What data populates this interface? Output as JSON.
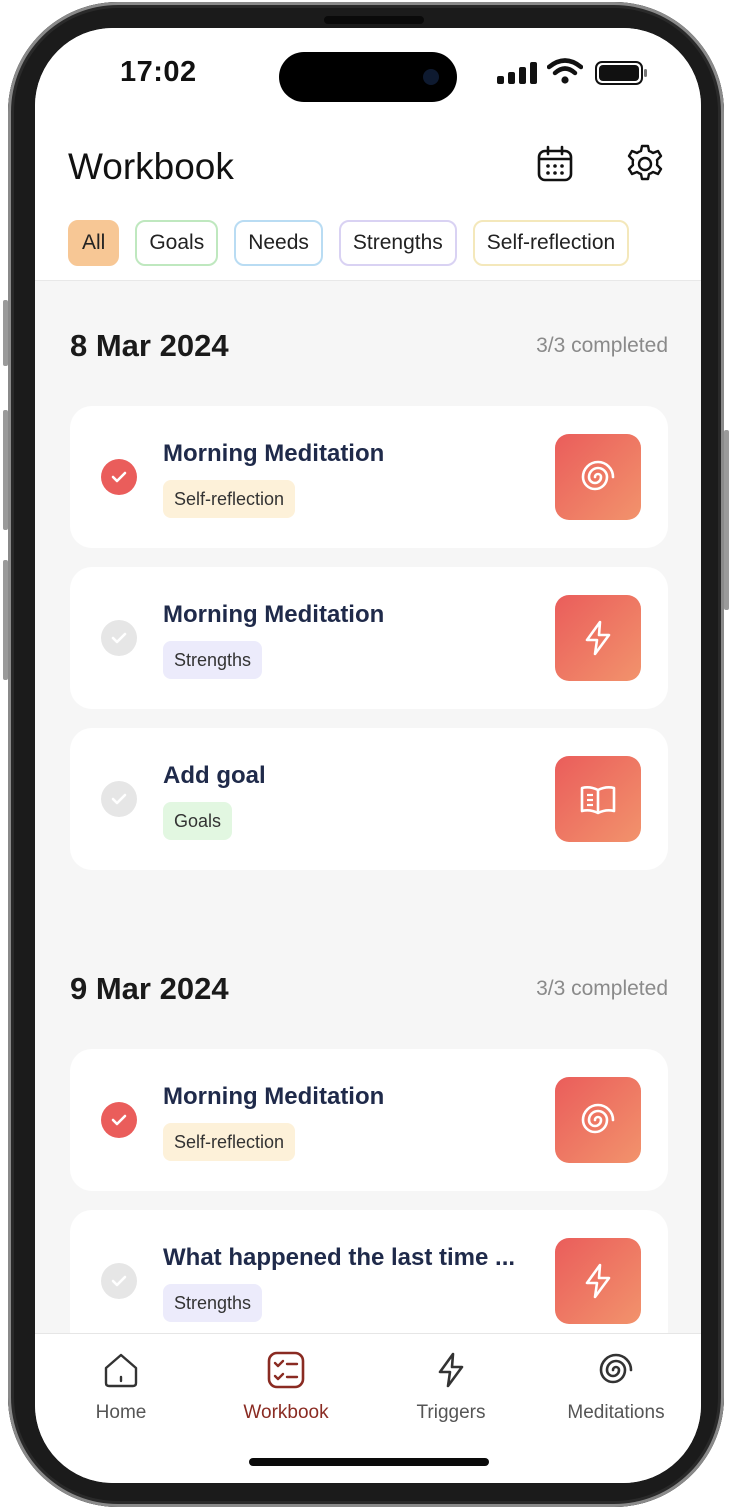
{
  "status_bar": {
    "time": "17:02"
  },
  "header": {
    "title": "Workbook",
    "filters": [
      {
        "label": "All",
        "selected": true,
        "color": "#f7c795"
      },
      {
        "label": "Goals",
        "selected": false,
        "color": "#bfe8bf"
      },
      {
        "label": "Needs",
        "selected": false,
        "color": "#b9dcf3"
      },
      {
        "label": "Strengths",
        "selected": false,
        "color": "#d9d2f3"
      },
      {
        "label": "Self-reflection",
        "selected": false,
        "color": "#f4e8bb"
      }
    ]
  },
  "days": [
    {
      "date": "8 Mar 2024",
      "progress": "3/3 completed",
      "items": [
        {
          "title": "Morning Meditation",
          "tag": "Self-reflection",
          "done": true,
          "icon": "spiral-icon"
        },
        {
          "title": "Morning Meditation",
          "tag": "Strengths",
          "done": false,
          "icon": "lightning-icon"
        },
        {
          "title": "Add goal",
          "tag": "Goals",
          "done": false,
          "icon": "book-icon"
        }
      ]
    },
    {
      "date": "9 Mar 2024",
      "progress": "3/3 completed",
      "items": [
        {
          "title": "Morning Meditation",
          "tag": "Self-reflection",
          "done": true,
          "icon": "spiral-icon"
        },
        {
          "title": "What happened the last time ...",
          "tag": "Strengths",
          "done": false,
          "icon": "lightning-icon"
        }
      ]
    }
  ],
  "tag_colors": {
    "Self-reflection": "#fdf1d9",
    "Strengths": "#ecebfb",
    "Goals": "#e2f7e1"
  },
  "colors": {
    "accent": "#ea5d5b",
    "active_tab": "#8a2b22",
    "check_done": "#ea5d5b",
    "check_todo": "#e6e6e6"
  },
  "tabbar": {
    "tabs": [
      {
        "label": "Home",
        "icon": "home-icon",
        "active": false
      },
      {
        "label": "Workbook",
        "icon": "workbook-icon",
        "active": true
      },
      {
        "label": "Triggers",
        "icon": "lightning-icon",
        "active": false
      },
      {
        "label": "Meditations",
        "icon": "spiral-icon",
        "active": false
      }
    ]
  }
}
